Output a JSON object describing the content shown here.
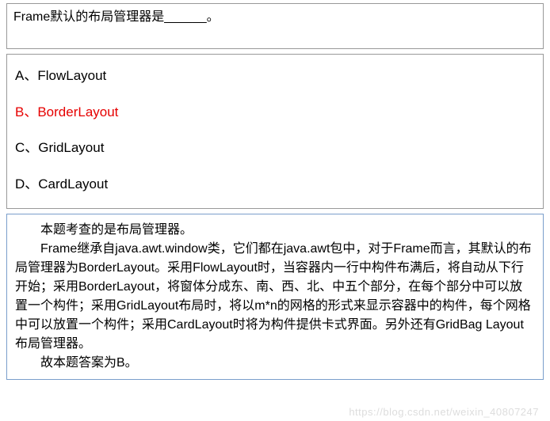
{
  "question": {
    "text": "Frame默认的布局管理器是______。"
  },
  "options": {
    "a": {
      "label": "A、",
      "text": "FlowLayout"
    },
    "b": {
      "label": "B、",
      "text": "BorderLayout"
    },
    "c": {
      "label": "C、",
      "text": "GridLayout"
    },
    "d": {
      "label": "D、",
      "text": "CardLayout"
    }
  },
  "explanation": {
    "p1": "本题考查的是布局管理器。",
    "p2": "Frame继承自java.awt.window类，它们都在java.awt包中，对于Frame而言，其默认的布局管理器为BorderLayout。采用FlowLayout时，当容器内一行中构件布满后，将自动从下行开始；采用BorderLayout，将窗体分成东、南、西、北、中五个部分，在每个部分中可以放置一个构件；采用GridLayout布局时，将以m*n的网格的形式来显示容器中的构件，每个网格中可以放置一个构件；采用CardLayout时将为构件提供卡式界面。另外还有GridBag Layout布局管理器。",
    "p3": "故本题答案为B。"
  },
  "watermark": "https://blog.csdn.net/weixin_40807247"
}
